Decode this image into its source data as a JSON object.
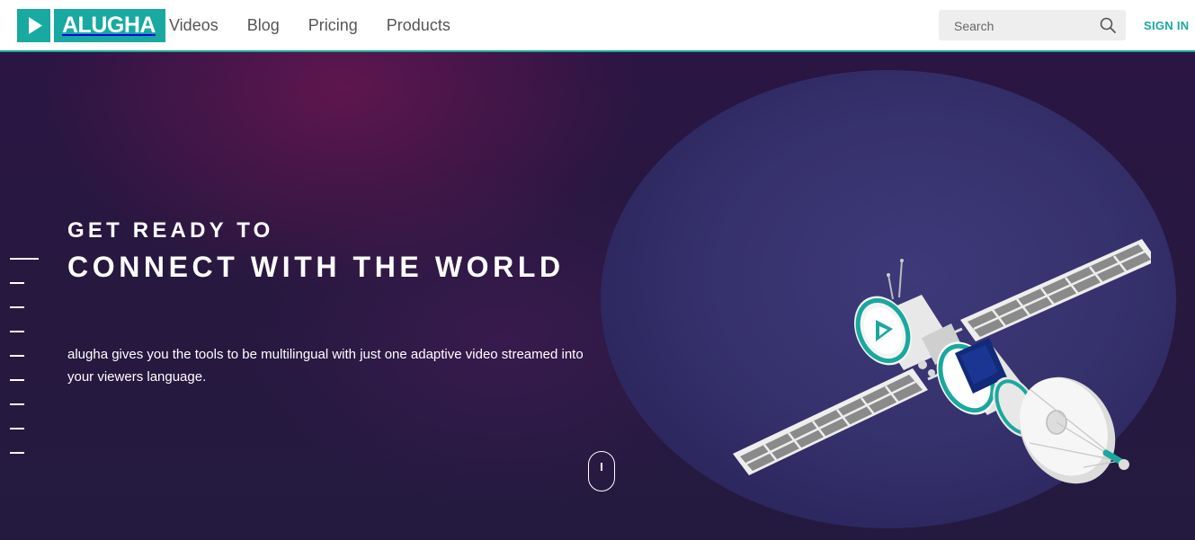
{
  "brand": {
    "name": "ALUGHA"
  },
  "nav": {
    "items": [
      {
        "label": "Videos"
      },
      {
        "label": "Blog"
      },
      {
        "label": "Pricing"
      },
      {
        "label": "Products"
      }
    ]
  },
  "search": {
    "placeholder": "Search"
  },
  "auth": {
    "signin_label": "SIGN IN"
  },
  "hero": {
    "kicker": "GET READY TO",
    "headline": "CONNECT WITH THE WORLD",
    "description": "alugha gives you the tools to be multilingual with just one adaptive video streamed into your viewers language."
  },
  "colors": {
    "accent": "#17a99f",
    "hero_bg": "#27183f",
    "planet": "#3a3675"
  },
  "icons": [
    "play-icon",
    "search-icon",
    "scroll-mouse-icon",
    "satellite-illustration"
  ]
}
